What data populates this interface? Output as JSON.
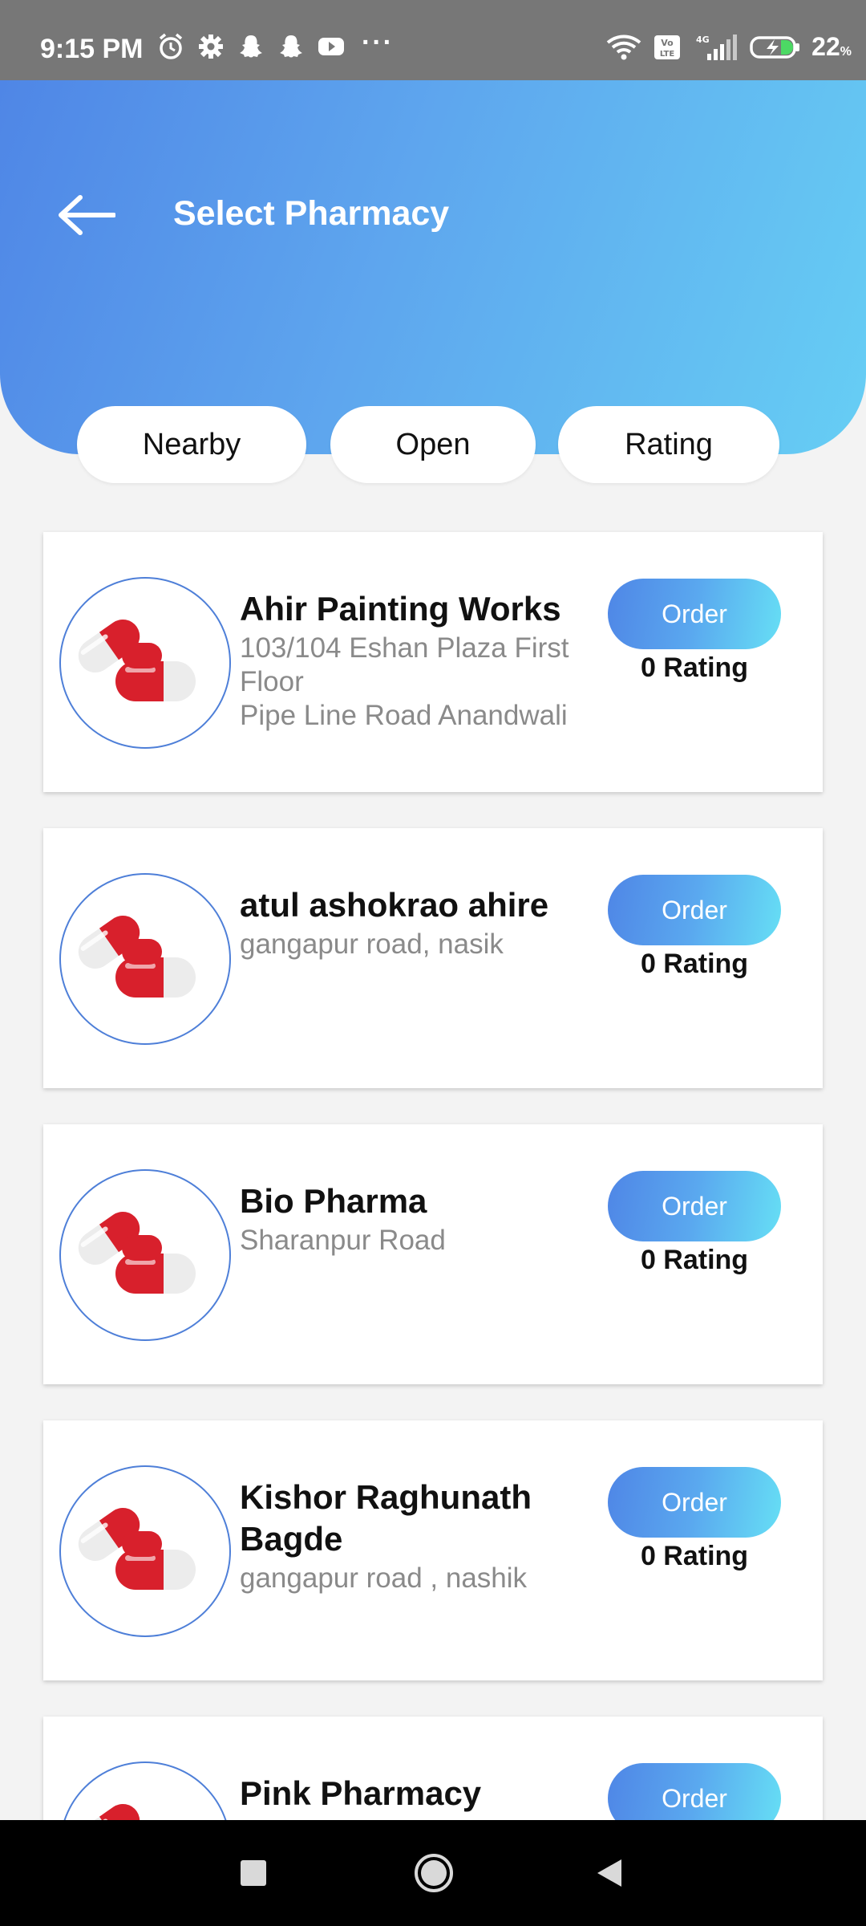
{
  "status_bar": {
    "time": "9:15 PM",
    "dots": "···",
    "battery": "22",
    "battery_unit": "%",
    "icons": [
      "alarm-icon",
      "gear-icon",
      "snapchat-icon",
      "snapchat-icon",
      "youtube-icon",
      "wifi-icon",
      "volte-icon",
      "signal-icon",
      "battery-icon"
    ]
  },
  "header": {
    "title": "Select Pharmacy",
    "back_icon": "arrow-left-icon"
  },
  "filters": {
    "nearby": "Nearby",
    "open": "Open",
    "rating": "Rating"
  },
  "pharmacies": [
    {
      "name": "Ahir Painting Works",
      "address": "103/104 Eshan Plaza First Floor\nPipe Line Road Anandwali",
      "order_label": "Order",
      "rating_text": "0 Rating",
      "icon": "pills-icon"
    },
    {
      "name": "atul ashokrao ahire",
      "address": "gangapur road, nasik",
      "order_label": "Order",
      "rating_text": "0 Rating",
      "icon": "pills-icon"
    },
    {
      "name": "Bio Pharma",
      "address": "Sharanpur Road",
      "order_label": "Order",
      "rating_text": "0 Rating",
      "icon": "pills-icon"
    },
    {
      "name": "Kishor Raghunath Bagde",
      "address": "gangapur road , nashik",
      "order_label": "Order",
      "rating_text": "0 Rating",
      "icon": "pills-icon"
    },
    {
      "name": "Pink Pharmacy",
      "address": "",
      "order_label": "Order",
      "rating_text": "",
      "icon": "pills-icon"
    }
  ],
  "nav_bar": {
    "icons": [
      "recents-square-icon",
      "home-circle-icon",
      "back-triangle-icon"
    ]
  },
  "colors": {
    "status_bar": "#777777",
    "header_start": "#4f86e6",
    "header_end": "#66cef4",
    "accent_border": "#4e7fd8",
    "pill_red": "#d8202c"
  }
}
